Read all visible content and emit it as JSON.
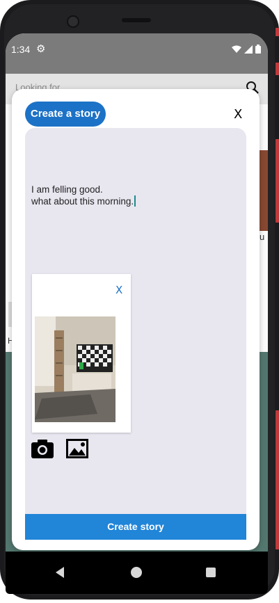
{
  "status_bar": {
    "time": "1:34",
    "settings_icon": "gear-icon",
    "wifi_icon": "wifi-icon",
    "signal_icon": "signal-icon",
    "battery_icon": "battery-icon"
  },
  "background_app": {
    "search_placeholder": "Looking for",
    "search_icon": "search-icon",
    "card_right_text": "u",
    "card_left_text": "H"
  },
  "dialog": {
    "title": "Create a story",
    "close_label": "X",
    "story_text": "I am felling good.\nwhat about this morning.",
    "attachment": {
      "close_label": "X",
      "image_desc": "room-with-tv-thumbnail"
    },
    "tools": {
      "camera_icon": "camera-icon",
      "gallery_icon": "image-icon"
    },
    "submit_label": "Create story"
  },
  "nav_bar": {
    "back_icon": "back-icon",
    "home_icon": "home-icon",
    "recents_icon": "recents-icon"
  },
  "colors": {
    "accent": "#1c72c6",
    "button": "#2185d8",
    "editor_bg": "#e8e6ef",
    "status_bar": "#7b7b7b"
  }
}
